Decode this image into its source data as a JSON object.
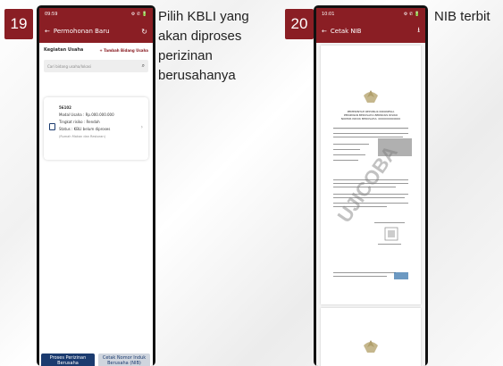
{
  "step19": {
    "number": "19",
    "caption_lines": [
      "Pilih KBLI yang",
      "akan diproses",
      "perizinan",
      "berusahanya"
    ],
    "status_time": "09:59",
    "status_right": "⚙ ✆ 🔋",
    "appbar_title": "Permohonan Baru",
    "section_title": "Kegiatan Usaha",
    "add_link": "+ Tambah Bidang Usaha",
    "search_placeholder": "Cari bidang usaha/lokasi",
    "card": {
      "code": "56102",
      "modal": "Modal Usaha : Rp.000.000.000",
      "risk": "Tingkat risiko : Rendah",
      "status": "Status : KBLI belum diproses",
      "sub": "(Rumah Makan dan Restoran)"
    },
    "button_primary": "Proses Perizinan Berusaha",
    "button_secondary": "Cetak Nomor Induk Berusaha (NIB)"
  },
  "step20": {
    "number": "20",
    "caption": "NIB terbit",
    "status_time": "10:01",
    "status_right": "⚙ ✆ 🔋",
    "appbar_title": "Cetak NIB",
    "watermark": "UJICOBA",
    "doc_heading": "PEMERINTAH REPUBLIK INDONESIA",
    "doc_subheading": "PERIZINAN BERUSAHA BERBASIS RISIKO",
    "doc_title": "NOMOR INDUK BERUSAHA: 0000000000000"
  },
  "colors": {
    "brand": "#8a1e24",
    "phone": "#111111"
  }
}
